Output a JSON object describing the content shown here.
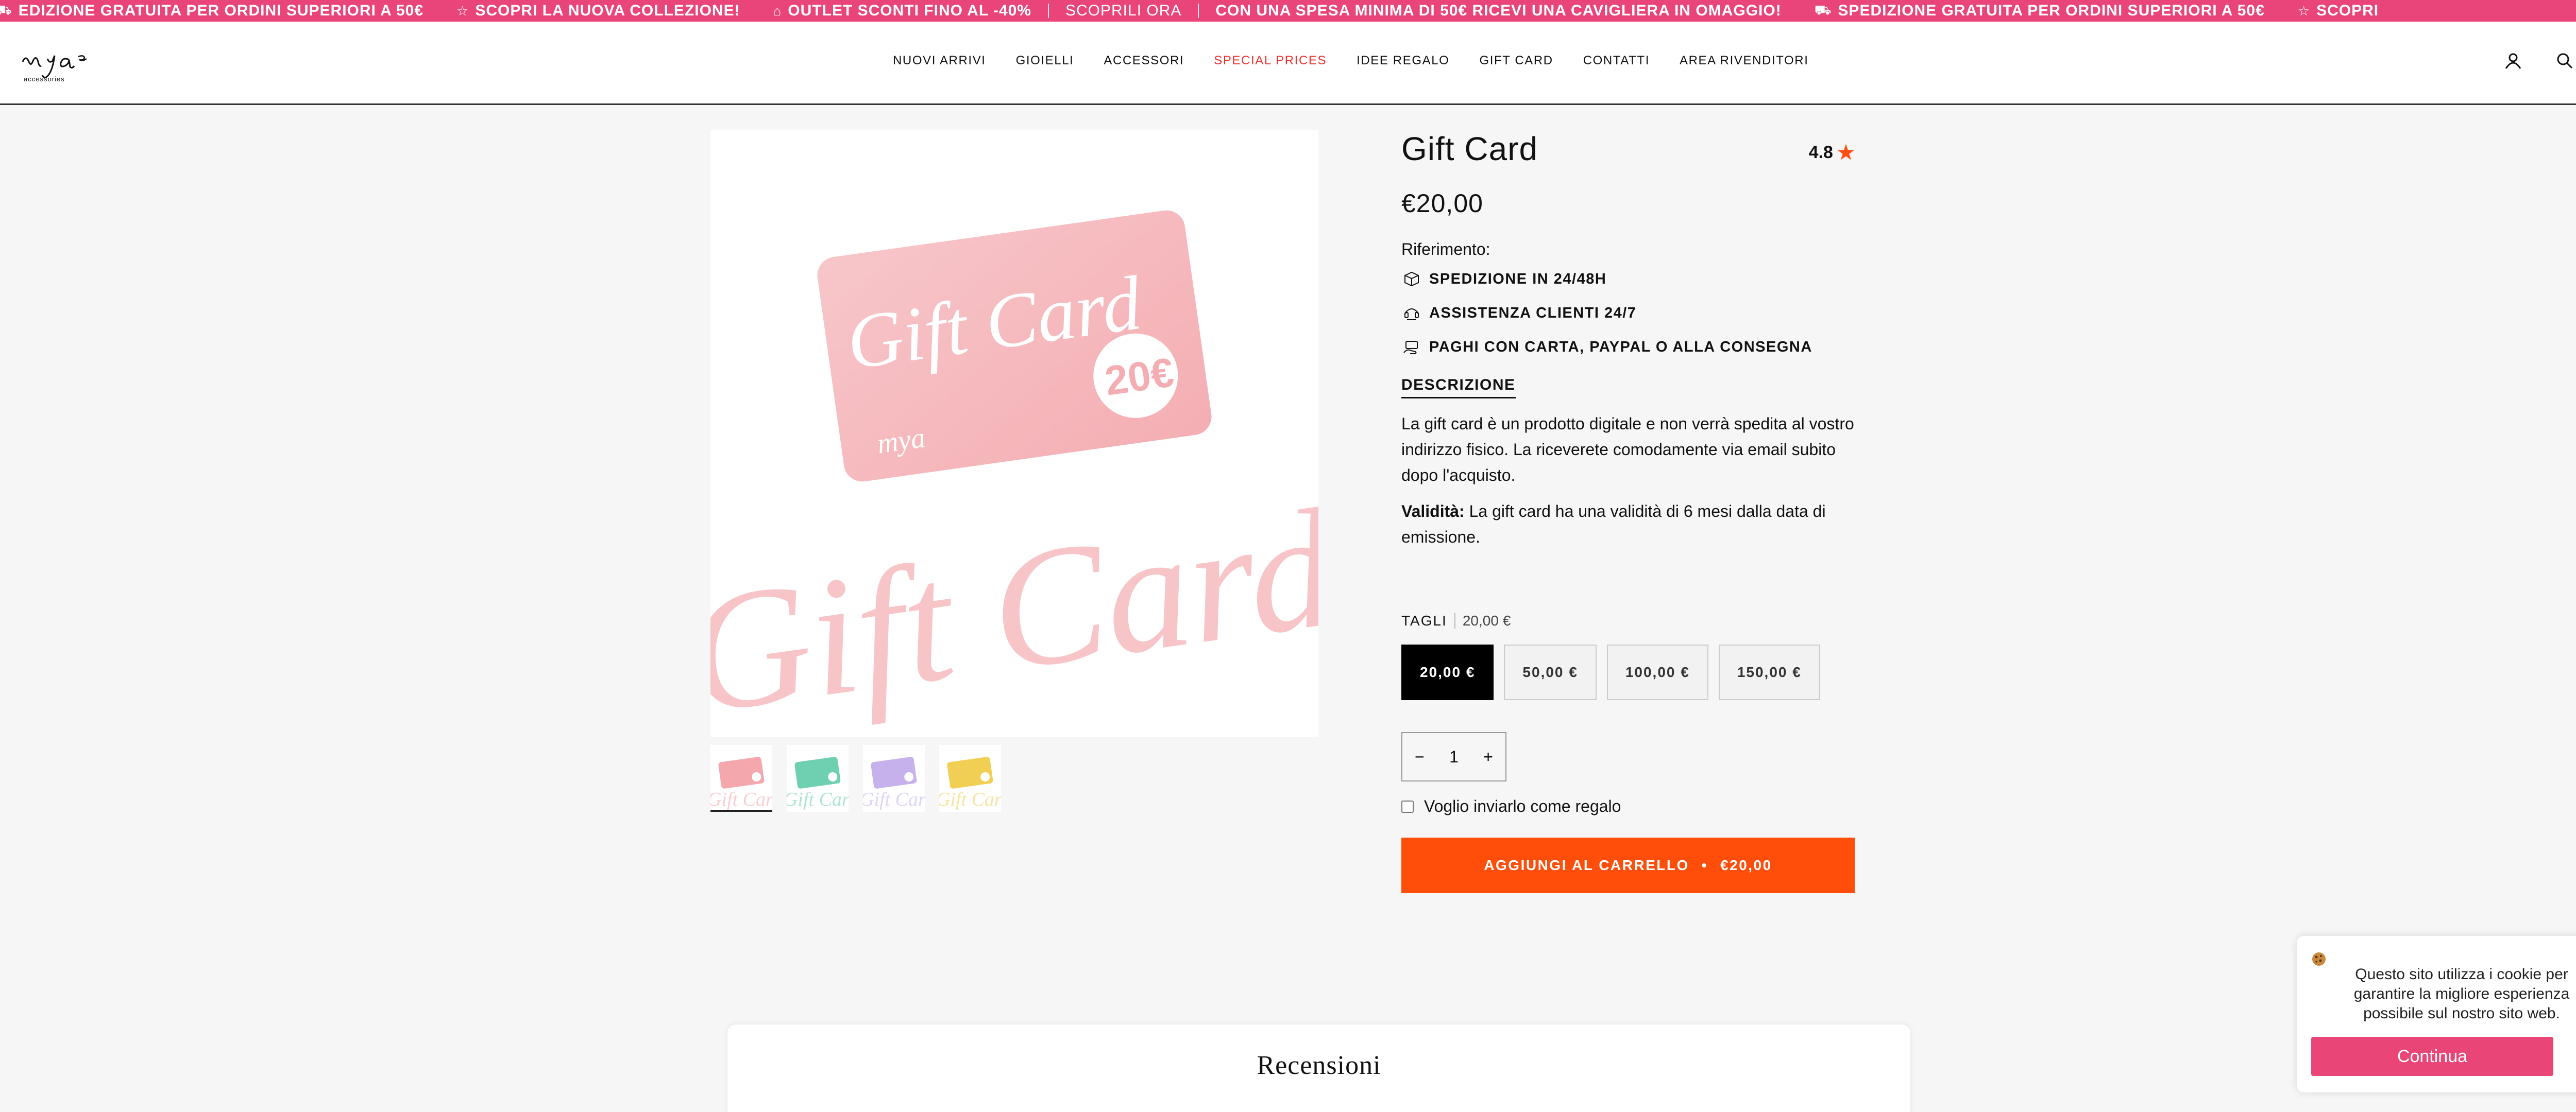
{
  "announcement": {
    "items": [
      {
        "icon": "truck-icon",
        "text": "EDIZIONE GRATUITA PER ORDINI SUPERIORI A 50€",
        "light": false
      },
      {
        "icon": "star-icon",
        "text": "SCOPRI LA NUOVA COLLEZIONE!",
        "light": false
      },
      {
        "icon": "tag-icon",
        "text": "OUTLET SCONTI FINO AL -40%",
        "light": false
      },
      {
        "icon": "",
        "text": "SCOPRILI ORA",
        "light": true
      },
      {
        "icon": "",
        "text": "CON UNA SPESA MINIMA DI 50€ RICEVI UNA CAVIGLIERA IN OMAGGIO!",
        "light": false
      },
      {
        "icon": "truck-icon",
        "text": "SPEDIZIONE GRATUITA PER ORDINI SUPERIORI A 50€",
        "light": false
      },
      {
        "icon": "star-icon",
        "text": "SCOPRI",
        "light": false
      }
    ]
  },
  "header": {
    "logo_text": "mya accessories",
    "nav": [
      {
        "label": "NUOVI ARRIVI",
        "special": false
      },
      {
        "label": "GIOIELLI",
        "special": false
      },
      {
        "label": "ACCESSORI",
        "special": false
      },
      {
        "label": "SPECIAL PRICES",
        "special": true
      },
      {
        "label": "IDEE REGALO",
        "special": false
      },
      {
        "label": "GIFT CARD",
        "special": false
      },
      {
        "label": "CONTATTI",
        "special": false
      },
      {
        "label": "AREA RIVENDITORI",
        "special": false
      }
    ],
    "icons": [
      "account-icon",
      "search-icon",
      "cart-icon"
    ]
  },
  "product": {
    "title": "Gift Card",
    "rating": "4.8",
    "price": "€20,00",
    "reference_label": "Riferimento:",
    "features": [
      {
        "icon": "shipping-box-icon",
        "text": "SPEDIZIONE IN 24/48H"
      },
      {
        "icon": "support-icon",
        "text": "ASSISTENZA CLIENTI 24/7"
      },
      {
        "icon": "payment-icon",
        "text": "PAGHI CON CARTA, PAYPAL O ALLA CONSEGNA"
      }
    ],
    "description_tab": "DESCRIZIONE",
    "description_p1": "La gift card è un prodotto digitale e non verrà spedita al vostro indirizzo fisico. La riceverete comodamente via email subito dopo l'acquisto.",
    "validity_label": "Validità:",
    "validity_text": " La gift card ha una validità di 6 mesi dalla data di emissione.",
    "variant_label": "TAGLI",
    "variant_value": "20,00 €",
    "variants": [
      "20,00 €",
      "50,00 €",
      "100,00 €",
      "150,00 €"
    ],
    "selected_variant": "20,00 €",
    "qty_minus": "−",
    "qty": "1",
    "qty_plus": "+",
    "gift_label": "Voglio inviarlo come regalo",
    "cart_label": "AGGIUNGI AL CARRELLO",
    "cart_dot": "•",
    "cart_price": "€20,00",
    "image": {
      "card_text": "Gift Card",
      "amount": "20€",
      "logo": "mya",
      "watermark": "Gift Card"
    },
    "thumbnails": [
      {
        "color": "#f4a7ad",
        "active": true
      },
      {
        "color": "#6fcfb1",
        "active": false
      },
      {
        "color": "#c6b1ec",
        "active": false
      },
      {
        "color": "#f1cf55",
        "active": false
      }
    ]
  },
  "reviews": {
    "title": "Recensioni"
  },
  "cookie": {
    "icon": "cookie-icon",
    "text": "Questo sito utilizza i cookie per garantire la migliore esperienza possibile sul nostro sito web.",
    "button": "Continua",
    "close": "✕"
  },
  "colors": {
    "accent": "#e9457a",
    "cart": "#ff4e0a",
    "special": "#e8322f",
    "whatsapp": "#25d366"
  }
}
